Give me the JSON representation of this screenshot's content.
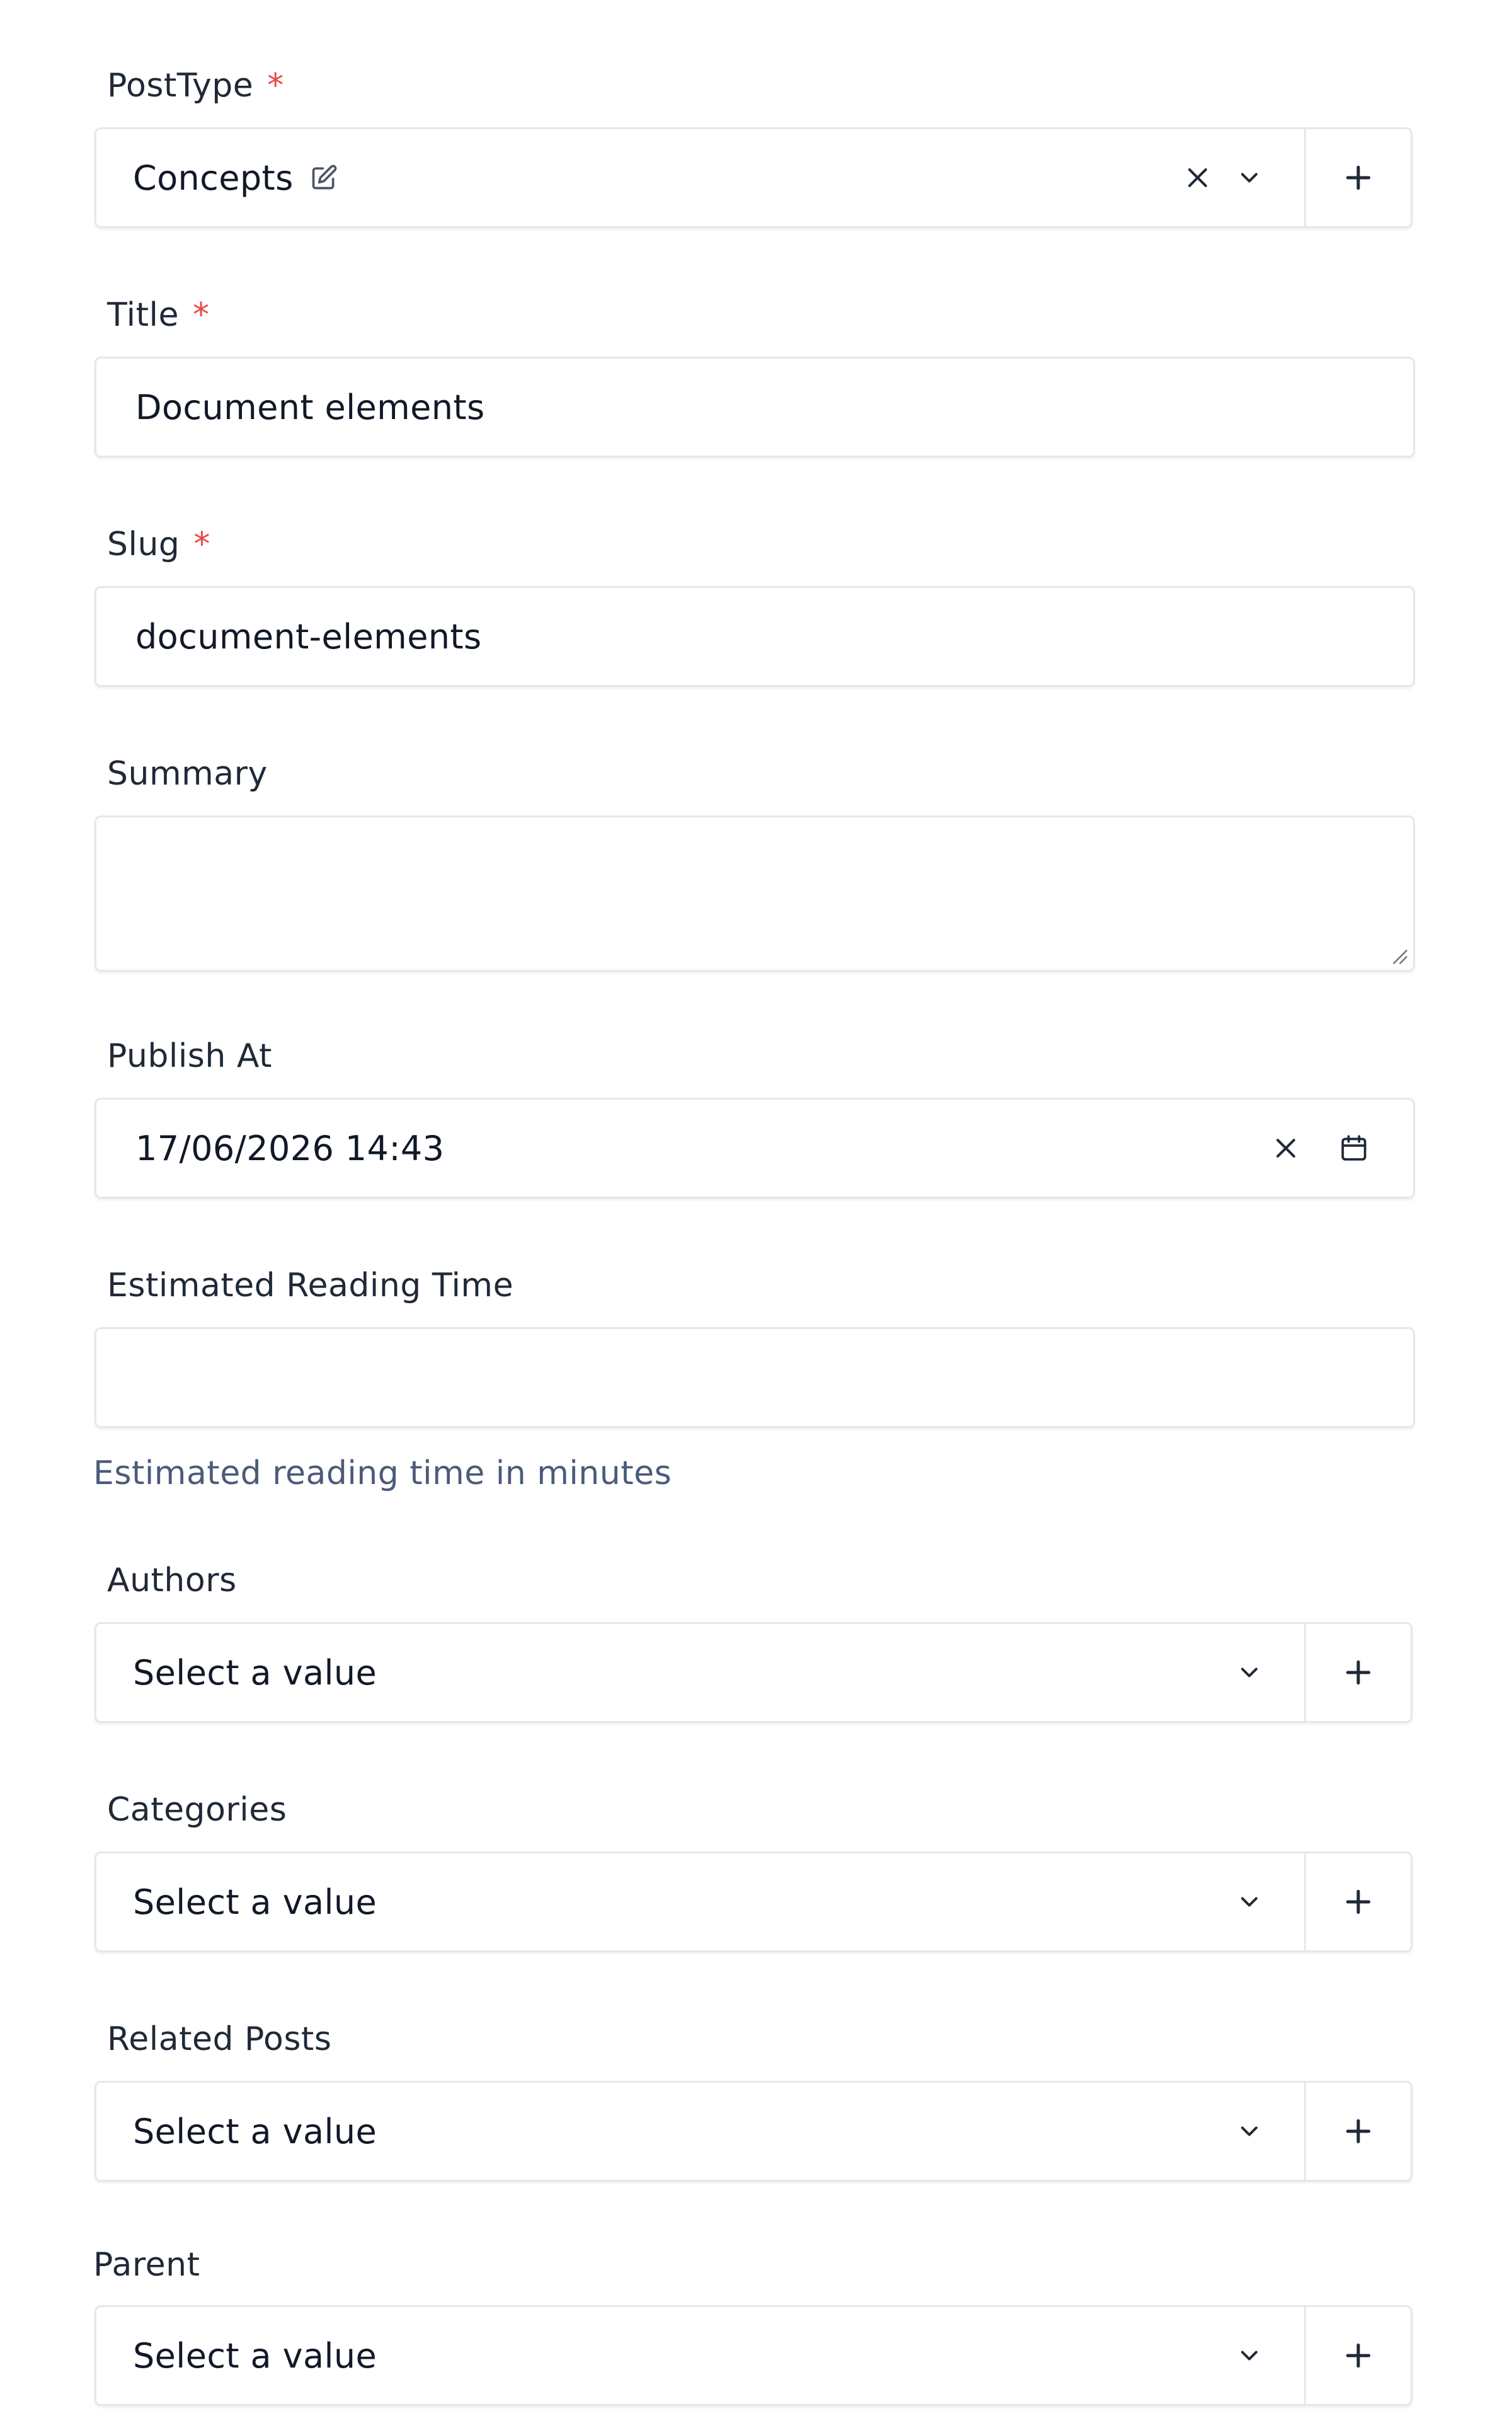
{
  "post_type": {
    "label": "PostType",
    "required_mark": "*",
    "value": "Concepts",
    "edit_icon": "edit-square-icon",
    "clear_icon": "close-icon",
    "chevron_icon": "chevron-down-icon",
    "add_icon": "plus-icon"
  },
  "title": {
    "label": "Title",
    "required_mark": "*",
    "value": "Document elements"
  },
  "slug": {
    "label": "Slug",
    "required_mark": "*",
    "value": "document-elements"
  },
  "summary": {
    "label": "Summary",
    "value": ""
  },
  "publish_at": {
    "label": "Publish At",
    "value": "17/06/2026 14:43",
    "clear_icon": "close-icon",
    "calendar_icon": "calendar-icon"
  },
  "reading_time": {
    "label": "Estimated Reading Time",
    "value": "",
    "help": "Estimated reading time in minutes"
  },
  "authors": {
    "label": "Authors",
    "placeholder": "Select a value"
  },
  "categories": {
    "label": "Categories",
    "placeholder": "Select a value"
  },
  "related_posts": {
    "label": "Related Posts",
    "placeholder": "Select a value"
  },
  "parent": {
    "label": "Parent",
    "placeholder": "Select a value"
  },
  "colors": {
    "required": "#ef4444",
    "border": "#e5e7eb",
    "help_text": "#4b5b7a"
  }
}
